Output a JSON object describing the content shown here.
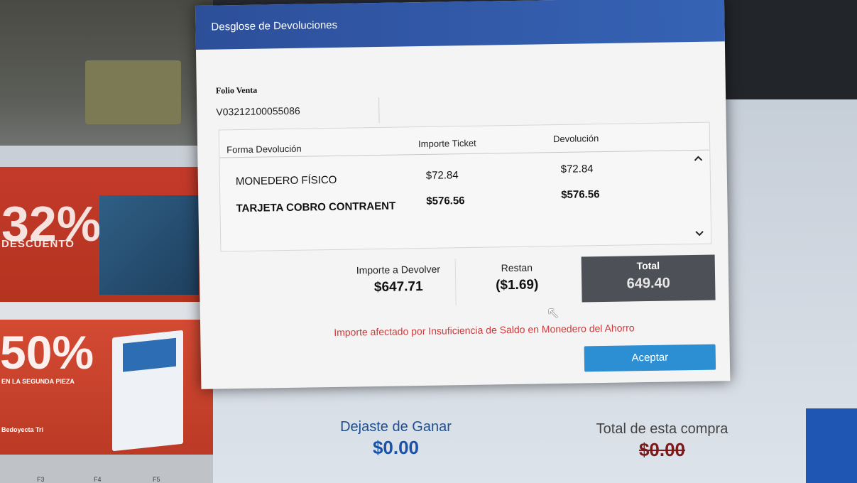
{
  "modal": {
    "title": "Desglose de Devoluciones",
    "folio_label": "Folio Venta",
    "folio_value": "V03212100055086",
    "grid": {
      "headers": [
        "Forma Devolución",
        "Importe Ticket",
        "Devolución"
      ],
      "rows": [
        {
          "forma": "MONEDERO FÍSICO",
          "importe": "$72.84",
          "devolucion": "$72.84",
          "bold": false
        },
        {
          "forma": "TARJETA COBRO CONTRAENT",
          "importe": "$576.56",
          "devolucion": "$576.56",
          "bold": true
        }
      ],
      "scroll_up_icon": "chevron-up-icon",
      "scroll_down_icon": "chevron-down-icon"
    },
    "totals": {
      "importe_label": "Importe a Devolver",
      "importe_value": "$647.71",
      "restan_label": "Restan",
      "restan_value": "($1.69)",
      "total_label": "Total",
      "total_value": "649.40"
    },
    "warning": "Importe afectado por Insuficiencia de Saldo en Monedero del Ahorro",
    "accept_label": "Aceptar"
  },
  "background": {
    "promo1_pct": "32%",
    "promo1_sub": "DESCUENTO",
    "promo2_pct": "50%",
    "promo2_sub": "EN LA SEGUNDA PIEZA",
    "promo2_brand": "Bedoyecta Tri",
    "dejaste_label": "Dejaste de Ganar",
    "dejaste_value": "$0.00",
    "total_compra_label": "Total de esta compra",
    "total_compra_value": "$0.00",
    "footer_keys": [
      "F3",
      "F4",
      "F5"
    ]
  },
  "colors": {
    "header_blue": "#2d4f9a",
    "accent_button": "#2c8ed3",
    "warning_red": "#d03a3a",
    "total_dark": "#4e5057",
    "summary_blue": "#1753a8"
  }
}
